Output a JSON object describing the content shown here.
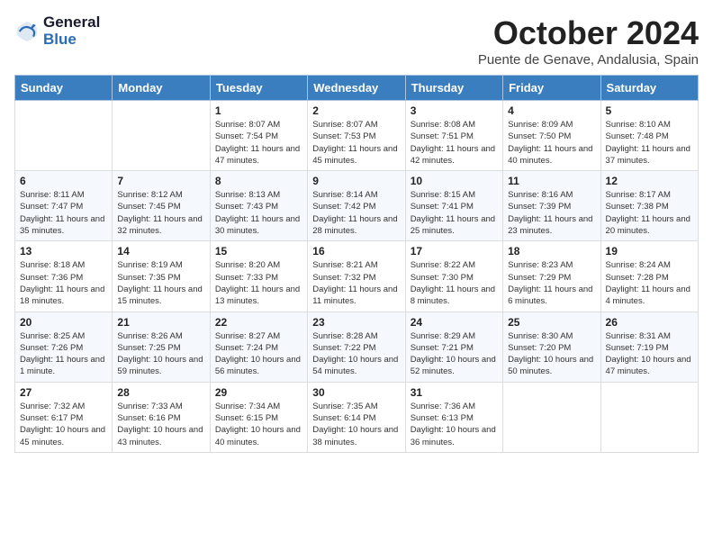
{
  "header": {
    "logo_line1": "General",
    "logo_line2": "Blue",
    "month_title": "October 2024",
    "location": "Puente de Genave, Andalusia, Spain"
  },
  "days_of_week": [
    "Sunday",
    "Monday",
    "Tuesday",
    "Wednesday",
    "Thursday",
    "Friday",
    "Saturday"
  ],
  "weeks": [
    [
      {
        "day": "",
        "info": ""
      },
      {
        "day": "",
        "info": ""
      },
      {
        "day": "1",
        "info": "Sunrise: 8:07 AM\nSunset: 7:54 PM\nDaylight: 11 hours and 47 minutes."
      },
      {
        "day": "2",
        "info": "Sunrise: 8:07 AM\nSunset: 7:53 PM\nDaylight: 11 hours and 45 minutes."
      },
      {
        "day": "3",
        "info": "Sunrise: 8:08 AM\nSunset: 7:51 PM\nDaylight: 11 hours and 42 minutes."
      },
      {
        "day": "4",
        "info": "Sunrise: 8:09 AM\nSunset: 7:50 PM\nDaylight: 11 hours and 40 minutes."
      },
      {
        "day": "5",
        "info": "Sunrise: 8:10 AM\nSunset: 7:48 PM\nDaylight: 11 hours and 37 minutes."
      }
    ],
    [
      {
        "day": "6",
        "info": "Sunrise: 8:11 AM\nSunset: 7:47 PM\nDaylight: 11 hours and 35 minutes."
      },
      {
        "day": "7",
        "info": "Sunrise: 8:12 AM\nSunset: 7:45 PM\nDaylight: 11 hours and 32 minutes."
      },
      {
        "day": "8",
        "info": "Sunrise: 8:13 AM\nSunset: 7:43 PM\nDaylight: 11 hours and 30 minutes."
      },
      {
        "day": "9",
        "info": "Sunrise: 8:14 AM\nSunset: 7:42 PM\nDaylight: 11 hours and 28 minutes."
      },
      {
        "day": "10",
        "info": "Sunrise: 8:15 AM\nSunset: 7:41 PM\nDaylight: 11 hours and 25 minutes."
      },
      {
        "day": "11",
        "info": "Sunrise: 8:16 AM\nSunset: 7:39 PM\nDaylight: 11 hours and 23 minutes."
      },
      {
        "day": "12",
        "info": "Sunrise: 8:17 AM\nSunset: 7:38 PM\nDaylight: 11 hours and 20 minutes."
      }
    ],
    [
      {
        "day": "13",
        "info": "Sunrise: 8:18 AM\nSunset: 7:36 PM\nDaylight: 11 hours and 18 minutes."
      },
      {
        "day": "14",
        "info": "Sunrise: 8:19 AM\nSunset: 7:35 PM\nDaylight: 11 hours and 15 minutes."
      },
      {
        "day": "15",
        "info": "Sunrise: 8:20 AM\nSunset: 7:33 PM\nDaylight: 11 hours and 13 minutes."
      },
      {
        "day": "16",
        "info": "Sunrise: 8:21 AM\nSunset: 7:32 PM\nDaylight: 11 hours and 11 minutes."
      },
      {
        "day": "17",
        "info": "Sunrise: 8:22 AM\nSunset: 7:30 PM\nDaylight: 11 hours and 8 minutes."
      },
      {
        "day": "18",
        "info": "Sunrise: 8:23 AM\nSunset: 7:29 PM\nDaylight: 11 hours and 6 minutes."
      },
      {
        "day": "19",
        "info": "Sunrise: 8:24 AM\nSunset: 7:28 PM\nDaylight: 11 hours and 4 minutes."
      }
    ],
    [
      {
        "day": "20",
        "info": "Sunrise: 8:25 AM\nSunset: 7:26 PM\nDaylight: 11 hours and 1 minute."
      },
      {
        "day": "21",
        "info": "Sunrise: 8:26 AM\nSunset: 7:25 PM\nDaylight: 10 hours and 59 minutes."
      },
      {
        "day": "22",
        "info": "Sunrise: 8:27 AM\nSunset: 7:24 PM\nDaylight: 10 hours and 56 minutes."
      },
      {
        "day": "23",
        "info": "Sunrise: 8:28 AM\nSunset: 7:22 PM\nDaylight: 10 hours and 54 minutes."
      },
      {
        "day": "24",
        "info": "Sunrise: 8:29 AM\nSunset: 7:21 PM\nDaylight: 10 hours and 52 minutes."
      },
      {
        "day": "25",
        "info": "Sunrise: 8:30 AM\nSunset: 7:20 PM\nDaylight: 10 hours and 50 minutes."
      },
      {
        "day": "26",
        "info": "Sunrise: 8:31 AM\nSunset: 7:19 PM\nDaylight: 10 hours and 47 minutes."
      }
    ],
    [
      {
        "day": "27",
        "info": "Sunrise: 7:32 AM\nSunset: 6:17 PM\nDaylight: 10 hours and 45 minutes."
      },
      {
        "day": "28",
        "info": "Sunrise: 7:33 AM\nSunset: 6:16 PM\nDaylight: 10 hours and 43 minutes."
      },
      {
        "day": "29",
        "info": "Sunrise: 7:34 AM\nSunset: 6:15 PM\nDaylight: 10 hours and 40 minutes."
      },
      {
        "day": "30",
        "info": "Sunrise: 7:35 AM\nSunset: 6:14 PM\nDaylight: 10 hours and 38 minutes."
      },
      {
        "day": "31",
        "info": "Sunrise: 7:36 AM\nSunset: 6:13 PM\nDaylight: 10 hours and 36 minutes."
      },
      {
        "day": "",
        "info": ""
      },
      {
        "day": "",
        "info": ""
      }
    ]
  ]
}
